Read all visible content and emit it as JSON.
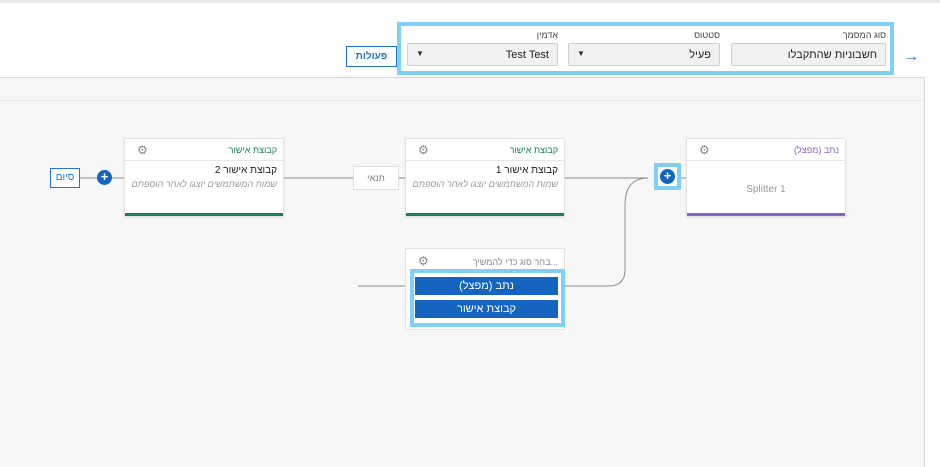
{
  "header": {
    "actions_label": "פעולות",
    "back_icon": "arrow-right-icon",
    "filters": [
      {
        "label": "סוג המסמך",
        "value": "חשבוניות שהתקבלו",
        "has_caret": false
      },
      {
        "label": "סטטוס",
        "value": "פעיל",
        "has_caret": true
      },
      {
        "label": "אדמין",
        "value": "Test Test",
        "has_caret": true
      }
    ]
  },
  "flow": {
    "end_label": "סיום",
    "condition_label": "תנאי",
    "nodes": [
      {
        "title": "נתב (מפצל)",
        "line1": "Splitter 1",
        "line2": "",
        "accent": "#8a63c8"
      },
      {
        "title": "קבוצת אישור",
        "line1": "קבוצת אישור 1",
        "line2": "שמות המשתמשים יוצגו לאחר הוספתם",
        "accent": "#1a7f5a"
      },
      {
        "title": "קבוצת אישור",
        "line1": "קבוצת אישור 2",
        "line2": "שמות המשתמשים יוצגו לאחר הוספתם",
        "accent": "#1a7f5a"
      }
    ],
    "chooser": {
      "title": "בחר סוג כדי להמשיך...",
      "options": [
        "נתב (מפצל)",
        "קבוצת אישור"
      ]
    }
  },
  "colors": {
    "primary": "#1565c0",
    "highlight": "#7fd1f3",
    "approval_accent": "#1a7f5a",
    "splitter_accent": "#8a63c8"
  }
}
